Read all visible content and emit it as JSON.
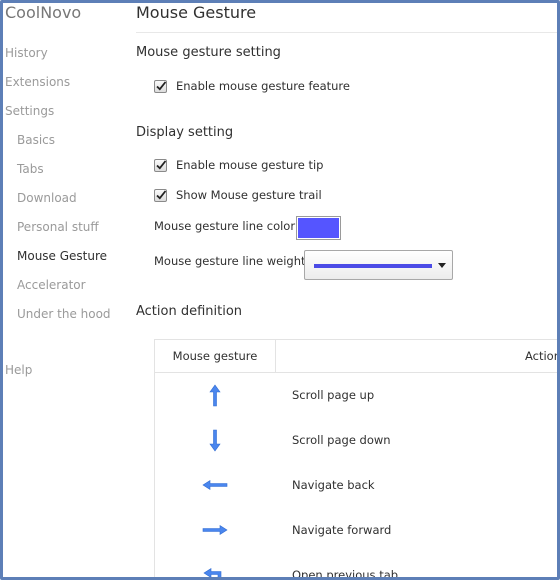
{
  "app": {
    "title": "CoolNovo"
  },
  "sidebar": {
    "top_items": [
      {
        "label": "History"
      },
      {
        "label": "Extensions"
      },
      {
        "label": "Settings"
      }
    ],
    "sub_items": [
      {
        "label": "Basics"
      },
      {
        "label": "Tabs"
      },
      {
        "label": "Download"
      },
      {
        "label": "Personal stuff"
      },
      {
        "label": "Mouse Gesture",
        "active": true
      },
      {
        "label": "Accelerator"
      },
      {
        "label": "Under the hood"
      }
    ],
    "help": {
      "label": "Help"
    }
  },
  "page": {
    "title": "Mouse Gesture",
    "mouse_gesture_setting": {
      "title": "Mouse gesture setting",
      "enable": {
        "label": "Enable mouse gesture feature",
        "checked": true
      }
    },
    "display_setting": {
      "title": "Display setting",
      "tip": {
        "label": "Enable mouse gesture tip",
        "checked": true
      },
      "trail": {
        "label": "Show Mouse gesture trail",
        "checked": true
      },
      "line_color": {
        "label": "Mouse gesture line color",
        "value": "#5555ff"
      },
      "line_weight": {
        "label": "Mouse gesture line weight",
        "line_color": "#4b4be6"
      }
    },
    "action_definition": {
      "title": "Action definition",
      "headers": {
        "gesture": "Mouse gesture",
        "action": "Action"
      },
      "rows": [
        {
          "icon": "arrow-up-icon",
          "action": "Scroll page up"
        },
        {
          "icon": "arrow-down-icon",
          "action": "Scroll page down"
        },
        {
          "icon": "arrow-left-icon",
          "action": "Navigate back"
        },
        {
          "icon": "arrow-right-icon",
          "action": "Navigate forward"
        },
        {
          "icon": "arrow-up-left-icon",
          "action": "Open previous tab"
        }
      ]
    }
  },
  "colors": {
    "accent": "#4a86ee",
    "frame_border": "#5d7fb7"
  }
}
